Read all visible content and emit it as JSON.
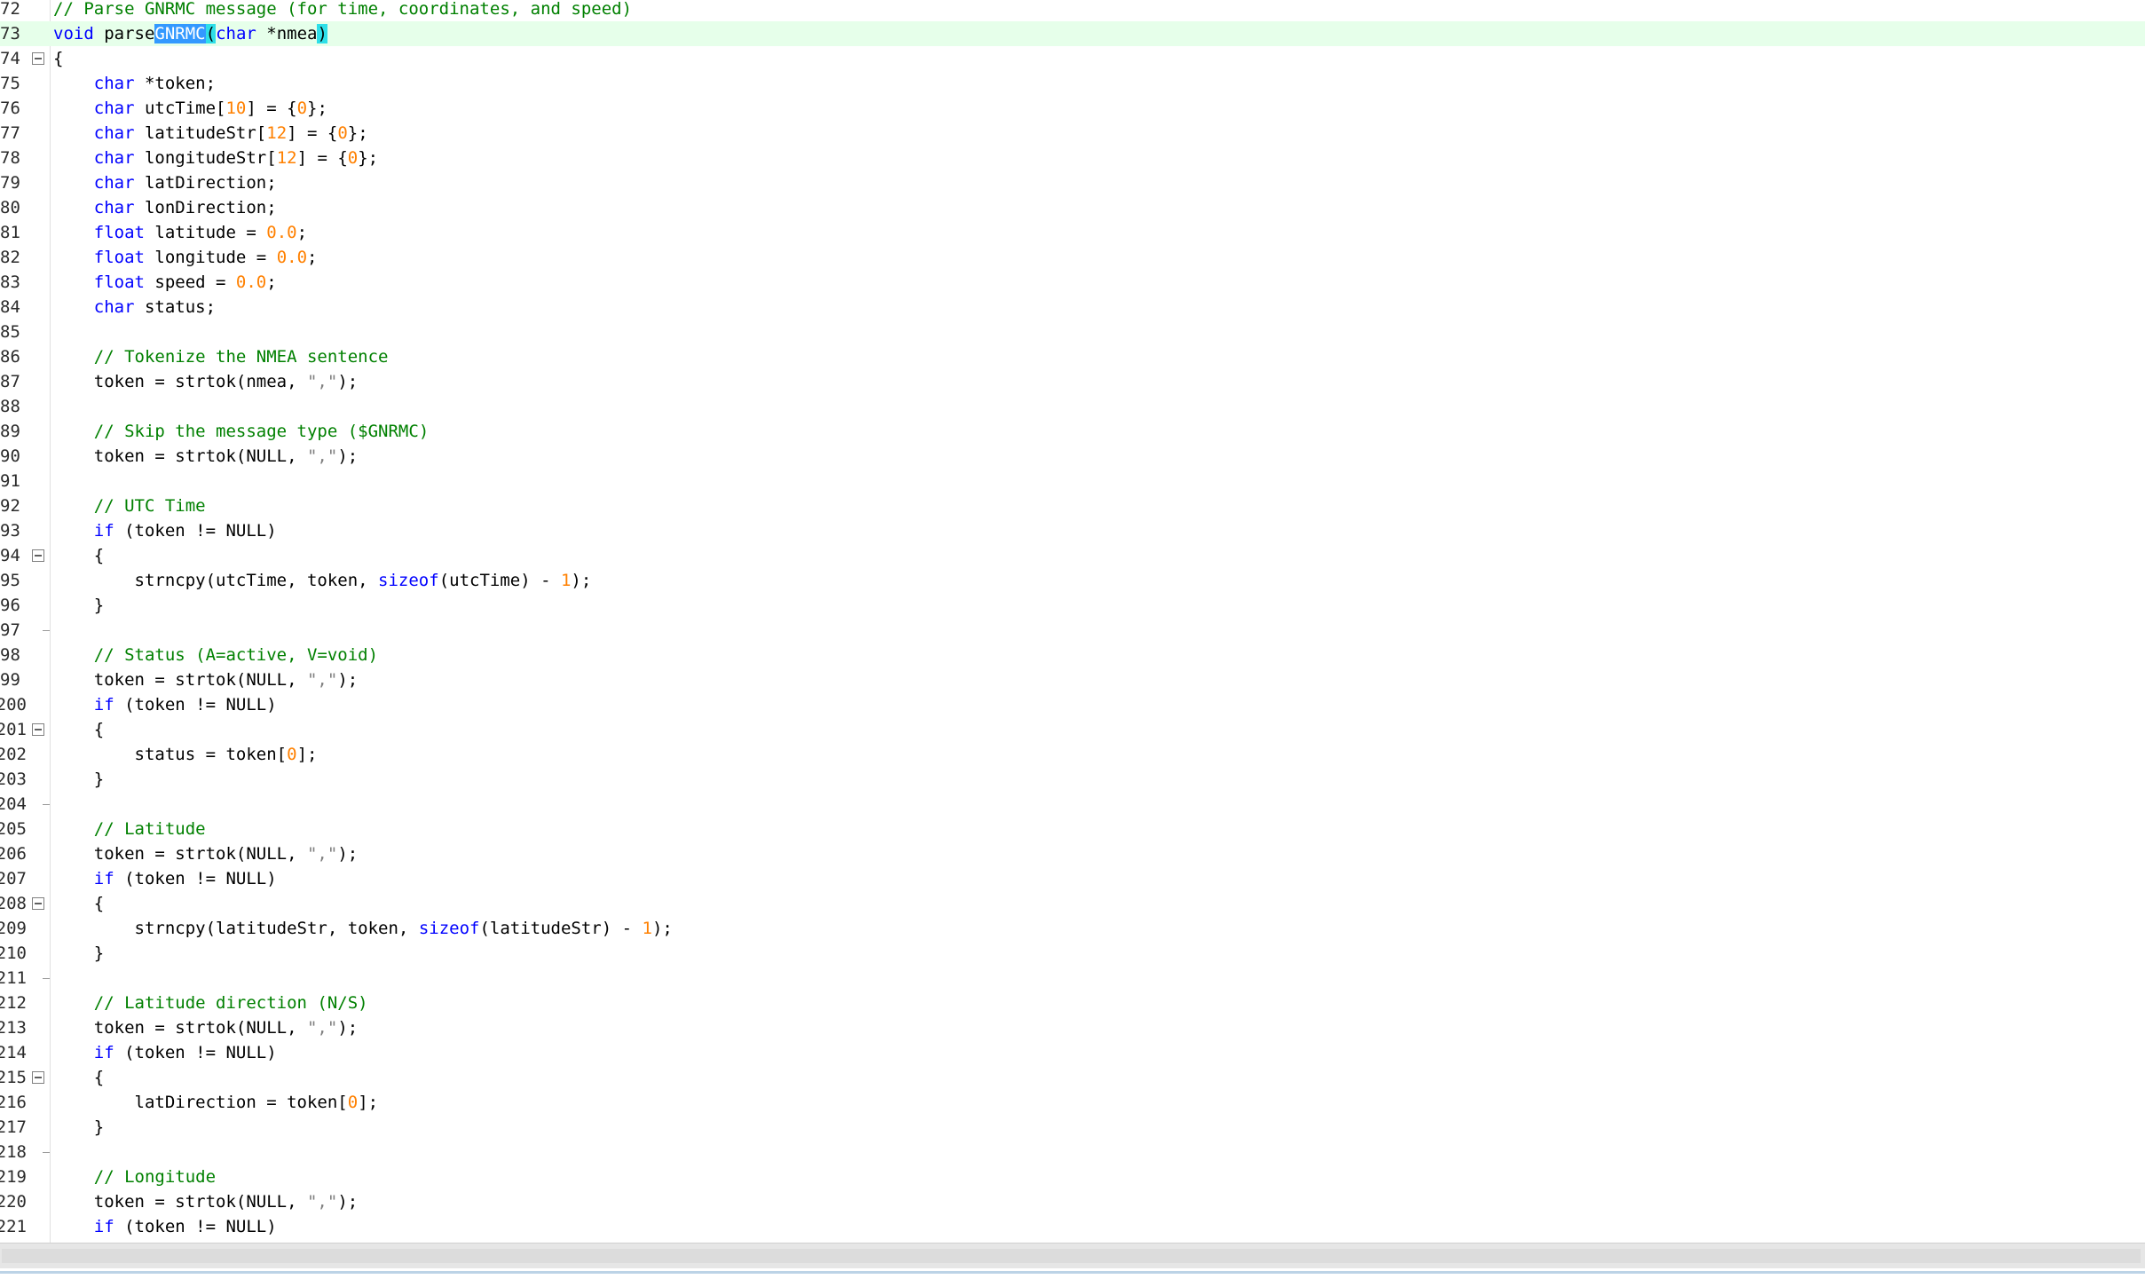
{
  "editor": {
    "lines": [
      {
        "n": "72",
        "fold": "",
        "hl": false,
        "segs": [
          [
            "com",
            "// Parse GNRMC message (for time, coordinates, and speed)"
          ]
        ]
      },
      {
        "n": "73",
        "fold": "",
        "hl": true,
        "segs": [
          [
            "kw",
            "void"
          ],
          [
            "txt",
            " parse"
          ],
          [
            "sel",
            "GNRMC"
          ],
          [
            "brace",
            "("
          ],
          [
            "kw",
            "char"
          ],
          [
            "txt",
            " *nmea"
          ],
          [
            "brace",
            ")"
          ]
        ]
      },
      {
        "n": "74",
        "fold": "open",
        "hl": false,
        "segs": [
          [
            "txt",
            "{"
          ]
        ]
      },
      {
        "n": "75",
        "fold": "",
        "hl": false,
        "segs": [
          [
            "txt",
            "    "
          ],
          [
            "kw",
            "char"
          ],
          [
            "txt",
            " *token;"
          ]
        ]
      },
      {
        "n": "76",
        "fold": "",
        "hl": false,
        "segs": [
          [
            "txt",
            "    "
          ],
          [
            "kw",
            "char"
          ],
          [
            "txt",
            " utcTime["
          ],
          [
            "num",
            "10"
          ],
          [
            "txt",
            "] = {"
          ],
          [
            "num",
            "0"
          ],
          [
            "txt",
            "};"
          ]
        ]
      },
      {
        "n": "77",
        "fold": "",
        "hl": false,
        "segs": [
          [
            "txt",
            "    "
          ],
          [
            "kw",
            "char"
          ],
          [
            "txt",
            " latitudeStr["
          ],
          [
            "num",
            "12"
          ],
          [
            "txt",
            "] = {"
          ],
          [
            "num",
            "0"
          ],
          [
            "txt",
            "};"
          ]
        ]
      },
      {
        "n": "78",
        "fold": "",
        "hl": false,
        "segs": [
          [
            "txt",
            "    "
          ],
          [
            "kw",
            "char"
          ],
          [
            "txt",
            " longitudeStr["
          ],
          [
            "num",
            "12"
          ],
          [
            "txt",
            "] = {"
          ],
          [
            "num",
            "0"
          ],
          [
            "txt",
            "};"
          ]
        ]
      },
      {
        "n": "79",
        "fold": "",
        "hl": false,
        "segs": [
          [
            "txt",
            "    "
          ],
          [
            "kw",
            "char"
          ],
          [
            "txt",
            " latDirection;"
          ]
        ]
      },
      {
        "n": "80",
        "fold": "",
        "hl": false,
        "segs": [
          [
            "txt",
            "    "
          ],
          [
            "kw",
            "char"
          ],
          [
            "txt",
            " lonDirection;"
          ]
        ]
      },
      {
        "n": "81",
        "fold": "",
        "hl": false,
        "segs": [
          [
            "txt",
            "    "
          ],
          [
            "kw",
            "float"
          ],
          [
            "txt",
            " latitude = "
          ],
          [
            "num",
            "0.0"
          ],
          [
            "txt",
            ";"
          ]
        ]
      },
      {
        "n": "82",
        "fold": "",
        "hl": false,
        "segs": [
          [
            "txt",
            "    "
          ],
          [
            "kw",
            "float"
          ],
          [
            "txt",
            " longitude = "
          ],
          [
            "num",
            "0.0"
          ],
          [
            "txt",
            ";"
          ]
        ]
      },
      {
        "n": "83",
        "fold": "",
        "hl": false,
        "segs": [
          [
            "txt",
            "    "
          ],
          [
            "kw",
            "float"
          ],
          [
            "txt",
            " speed = "
          ],
          [
            "num",
            "0.0"
          ],
          [
            "txt",
            ";"
          ]
        ]
      },
      {
        "n": "84",
        "fold": "",
        "hl": false,
        "segs": [
          [
            "txt",
            "    "
          ],
          [
            "kw",
            "char"
          ],
          [
            "txt",
            " status;"
          ]
        ]
      },
      {
        "n": "85",
        "fold": "",
        "hl": false,
        "segs": []
      },
      {
        "n": "86",
        "fold": "",
        "hl": false,
        "segs": [
          [
            "txt",
            "    "
          ],
          [
            "com",
            "// Tokenize the NMEA sentence"
          ]
        ]
      },
      {
        "n": "87",
        "fold": "",
        "hl": false,
        "segs": [
          [
            "txt",
            "    token = strtok(nmea, "
          ],
          [
            "str",
            "\",\""
          ],
          [
            "txt",
            ");"
          ]
        ]
      },
      {
        "n": "88",
        "fold": "",
        "hl": false,
        "segs": []
      },
      {
        "n": "89",
        "fold": "",
        "hl": false,
        "segs": [
          [
            "txt",
            "    "
          ],
          [
            "com",
            "// Skip the message type ($GNRMC)"
          ]
        ]
      },
      {
        "n": "90",
        "fold": "",
        "hl": false,
        "segs": [
          [
            "txt",
            "    token = strtok(NULL, "
          ],
          [
            "str",
            "\",\""
          ],
          [
            "txt",
            ");"
          ]
        ]
      },
      {
        "n": "91",
        "fold": "",
        "hl": false,
        "segs": []
      },
      {
        "n": "92",
        "fold": "",
        "hl": false,
        "segs": [
          [
            "txt",
            "    "
          ],
          [
            "com",
            "// UTC Time"
          ]
        ]
      },
      {
        "n": "93",
        "fold": "",
        "hl": false,
        "segs": [
          [
            "txt",
            "    "
          ],
          [
            "kw",
            "if"
          ],
          [
            "txt",
            " (token != NULL)"
          ]
        ]
      },
      {
        "n": "94",
        "fold": "open",
        "hl": false,
        "segs": [
          [
            "txt",
            "    {"
          ]
        ]
      },
      {
        "n": "95",
        "fold": "",
        "hl": false,
        "segs": [
          [
            "txt",
            "        strncpy(utcTime, token, "
          ],
          [
            "kw",
            "sizeof"
          ],
          [
            "txt",
            "(utcTime) - "
          ],
          [
            "num",
            "1"
          ],
          [
            "txt",
            ");"
          ]
        ]
      },
      {
        "n": "96",
        "fold": "",
        "hl": false,
        "segs": [
          [
            "txt",
            "    }"
          ]
        ]
      },
      {
        "n": "97",
        "fold": "end",
        "hl": false,
        "segs": []
      },
      {
        "n": "98",
        "fold": "",
        "hl": false,
        "segs": [
          [
            "txt",
            "    "
          ],
          [
            "com",
            "// Status (A=active, V=void)"
          ]
        ]
      },
      {
        "n": "99",
        "fold": "",
        "hl": false,
        "segs": [
          [
            "txt",
            "    token = strtok(NULL, "
          ],
          [
            "str",
            "\",\""
          ],
          [
            "txt",
            ");"
          ]
        ]
      },
      {
        "n": "200",
        "fold": "",
        "hl": false,
        "segs": [
          [
            "txt",
            "    "
          ],
          [
            "kw",
            "if"
          ],
          [
            "txt",
            " (token != NULL)"
          ]
        ]
      },
      {
        "n": "201",
        "fold": "open",
        "hl": false,
        "segs": [
          [
            "txt",
            "    {"
          ]
        ]
      },
      {
        "n": "202",
        "fold": "",
        "hl": false,
        "segs": [
          [
            "txt",
            "        status = token["
          ],
          [
            "num",
            "0"
          ],
          [
            "txt",
            "];"
          ]
        ]
      },
      {
        "n": "203",
        "fold": "",
        "hl": false,
        "segs": [
          [
            "txt",
            "    }"
          ]
        ]
      },
      {
        "n": "204",
        "fold": "end",
        "hl": false,
        "segs": []
      },
      {
        "n": "205",
        "fold": "",
        "hl": false,
        "segs": [
          [
            "txt",
            "    "
          ],
          [
            "com",
            "// Latitude"
          ]
        ]
      },
      {
        "n": "206",
        "fold": "",
        "hl": false,
        "segs": [
          [
            "txt",
            "    token = strtok(NULL, "
          ],
          [
            "str",
            "\",\""
          ],
          [
            "txt",
            ");"
          ]
        ]
      },
      {
        "n": "207",
        "fold": "",
        "hl": false,
        "segs": [
          [
            "txt",
            "    "
          ],
          [
            "kw",
            "if"
          ],
          [
            "txt",
            " (token != NULL)"
          ]
        ]
      },
      {
        "n": "208",
        "fold": "open",
        "hl": false,
        "segs": [
          [
            "txt",
            "    {"
          ]
        ]
      },
      {
        "n": "209",
        "fold": "",
        "hl": false,
        "segs": [
          [
            "txt",
            "        strncpy(latitudeStr, token, "
          ],
          [
            "kw",
            "sizeof"
          ],
          [
            "txt",
            "(latitudeStr) - "
          ],
          [
            "num",
            "1"
          ],
          [
            "txt",
            ");"
          ]
        ]
      },
      {
        "n": "210",
        "fold": "",
        "hl": false,
        "segs": [
          [
            "txt",
            "    }"
          ]
        ]
      },
      {
        "n": "211",
        "fold": "end",
        "hl": false,
        "segs": []
      },
      {
        "n": "212",
        "fold": "",
        "hl": false,
        "segs": [
          [
            "txt",
            "    "
          ],
          [
            "com",
            "// Latitude direction (N/S)"
          ]
        ]
      },
      {
        "n": "213",
        "fold": "",
        "hl": false,
        "segs": [
          [
            "txt",
            "    token = strtok(NULL, "
          ],
          [
            "str",
            "\",\""
          ],
          [
            "txt",
            ");"
          ]
        ]
      },
      {
        "n": "214",
        "fold": "",
        "hl": false,
        "segs": [
          [
            "txt",
            "    "
          ],
          [
            "kw",
            "if"
          ],
          [
            "txt",
            " (token != NULL)"
          ]
        ]
      },
      {
        "n": "215",
        "fold": "open",
        "hl": false,
        "segs": [
          [
            "txt",
            "    {"
          ]
        ]
      },
      {
        "n": "216",
        "fold": "",
        "hl": false,
        "segs": [
          [
            "txt",
            "        latDirection = token["
          ],
          [
            "num",
            "0"
          ],
          [
            "txt",
            "];"
          ]
        ]
      },
      {
        "n": "217",
        "fold": "",
        "hl": false,
        "segs": [
          [
            "txt",
            "    }"
          ]
        ]
      },
      {
        "n": "218",
        "fold": "end",
        "hl": false,
        "segs": []
      },
      {
        "n": "219",
        "fold": "",
        "hl": false,
        "segs": [
          [
            "txt",
            "    "
          ],
          [
            "com",
            "// Longitude"
          ]
        ]
      },
      {
        "n": "220",
        "fold": "",
        "hl": false,
        "segs": [
          [
            "txt",
            "    token = strtok(NULL, "
          ],
          [
            "str",
            "\",\""
          ],
          [
            "txt",
            ");"
          ]
        ]
      },
      {
        "n": "221",
        "fold": "",
        "hl": false,
        "segs": [
          [
            "txt",
            "    "
          ],
          [
            "kw",
            "if"
          ],
          [
            "txt",
            " (token != NULL)"
          ]
        ]
      }
    ]
  }
}
